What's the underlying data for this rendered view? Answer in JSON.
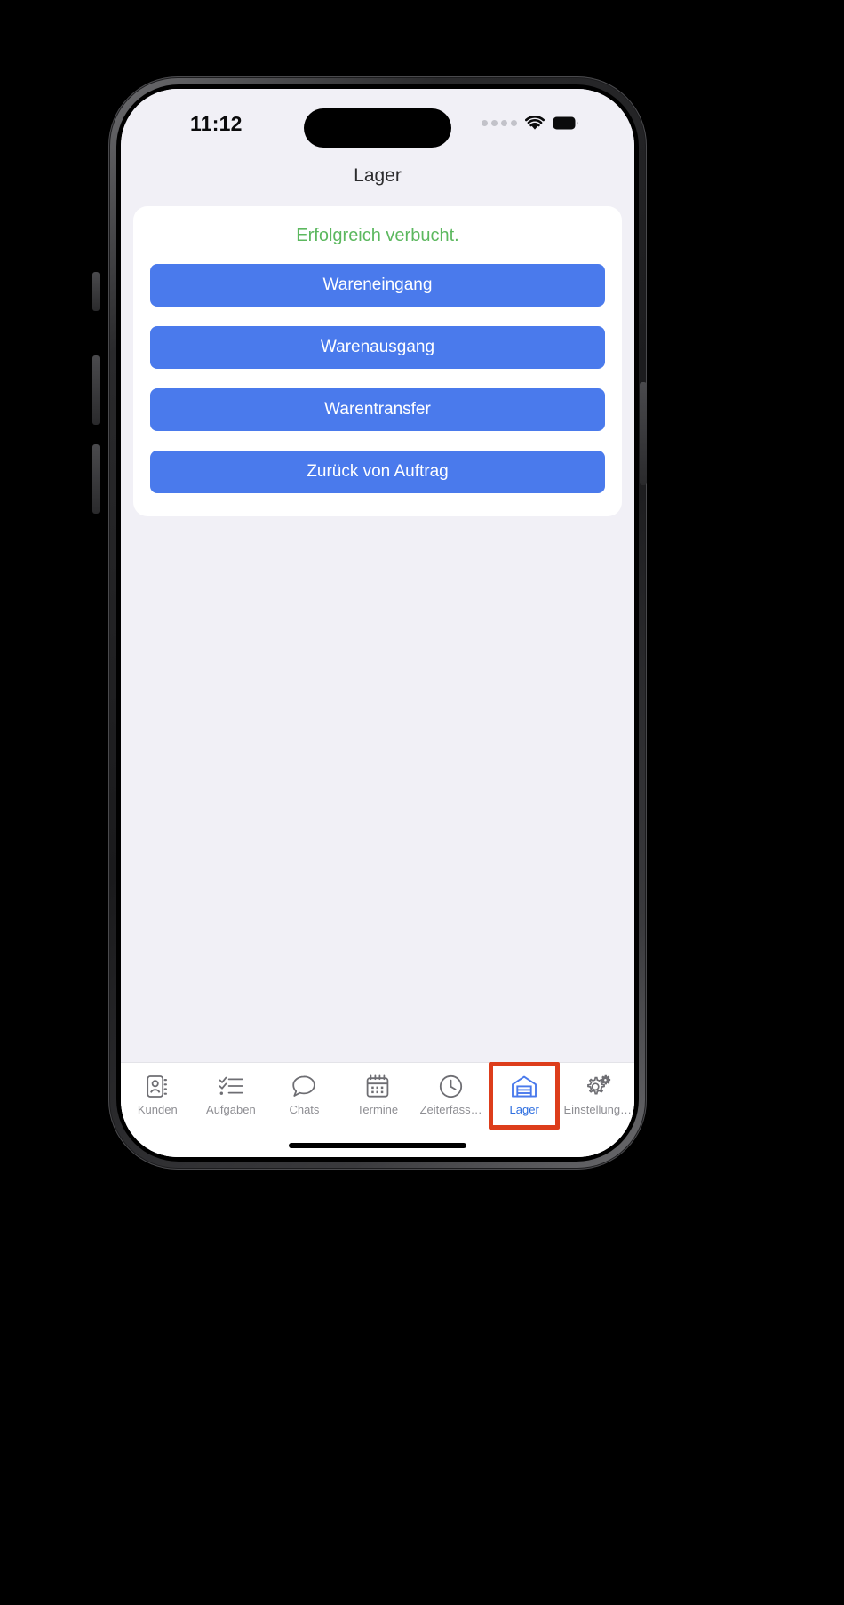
{
  "status_bar": {
    "time": "11:12",
    "signal_icon": "signal-dots-icon",
    "wifi_icon": "wifi-icon",
    "battery_icon": "battery-full-icon"
  },
  "nav": {
    "title": "Lager"
  },
  "main": {
    "status_message": "Erfolgreich verbucht.",
    "status_message_color": "#5cb85f",
    "button_color": "#4a7aec",
    "buttons": [
      {
        "label": "Wareneingang",
        "name": "wareneingang-button"
      },
      {
        "label": "Warenausgang",
        "name": "warenausgang-button"
      },
      {
        "label": "Warentransfer",
        "name": "warentransfer-button"
      },
      {
        "label": "Zurück von Auftrag",
        "name": "zurueck-von-auftrag-button"
      }
    ]
  },
  "tab_bar": {
    "active_color": "#2f6fe0",
    "inactive_color": "#8e8e93",
    "highlight_color": "#dd3d1b",
    "items": [
      {
        "label": "Kunden",
        "icon": "contacts-book-icon",
        "active": false
      },
      {
        "label": "Aufgaben",
        "icon": "checklist-icon",
        "active": false
      },
      {
        "label": "Chats",
        "icon": "chat-bubble-icon",
        "active": false
      },
      {
        "label": "Termine",
        "icon": "calendar-icon",
        "active": false
      },
      {
        "label": "Zeiterfass…",
        "icon": "clock-icon",
        "active": false
      },
      {
        "label": "Lager",
        "icon": "warehouse-icon",
        "active": true
      },
      {
        "label": "Einstellung…",
        "icon": "gear-icon",
        "active": false
      }
    ]
  }
}
